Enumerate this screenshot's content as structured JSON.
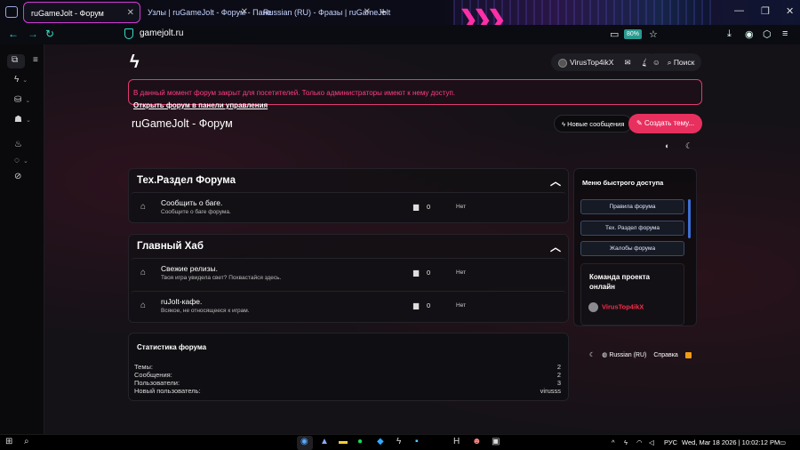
{
  "browser": {
    "tabs": [
      {
        "label": "ruGameJolt - Форум",
        "active": true
      },
      {
        "label": "Узлы | ruGameJolt - Форум - Пане",
        "active": false
      },
      {
        "label": "Russian (RU) - Фразы | ruGameJolt",
        "active": false
      }
    ],
    "url": "gamejolt.ru",
    "zoom": "80%"
  },
  "user": {
    "name": "VirusTop4ikX"
  },
  "search": {
    "label": "Поиск"
  },
  "notice": {
    "message": "В данный момент форум закрыт для посетителей. Только администраторы имеют к нему доступ.",
    "link": "Открыть форум в панели управления"
  },
  "forum": {
    "title": "ruGameJolt - Форум",
    "new_posts_label": "Новые сообщения",
    "create_thread_label": "Создать тему..."
  },
  "sections": [
    {
      "title": "Тех.Раздел Форума",
      "nodes": [
        {
          "title": "Сообщить о баге.",
          "desc": "Сообщите о баге форума.",
          "count": "0",
          "last": "Нет"
        }
      ]
    },
    {
      "title": "Главный Хаб",
      "nodes": [
        {
          "title": "Свежие релизы.",
          "desc": "Твоя игра увидела свет? Похвастайся здесь.",
          "count": "0",
          "last": "Нет"
        },
        {
          "title": "ruJolt-кафе.",
          "desc": "Всякое, не относящееся к играм.",
          "count": "0",
          "last": "Нет"
        }
      ]
    }
  ],
  "stats": {
    "title": "Статистика форума",
    "rows": [
      {
        "label": "Темы:",
        "value": "2"
      },
      {
        "label": "Сообщения:",
        "value": "2"
      },
      {
        "label": "Пользователи:",
        "value": "3"
      },
      {
        "label": "Новый пользователь:",
        "value": "virusss"
      }
    ]
  },
  "quick_menu": {
    "title": "Меню быстрого доступа",
    "buttons": [
      "Правила форума",
      "Тех. Раздел форума",
      "Жалобы форума"
    ],
    "team_title": "Команда проекта онлайн",
    "team_member": "VirusTop4ikX"
  },
  "footer": {
    "language": "Russian (RU)",
    "help": "Справка"
  },
  "taskbar": {
    "lang": "РУС",
    "datetime": "Wed, Mar 18 2026 | 10:02:12 PM"
  }
}
